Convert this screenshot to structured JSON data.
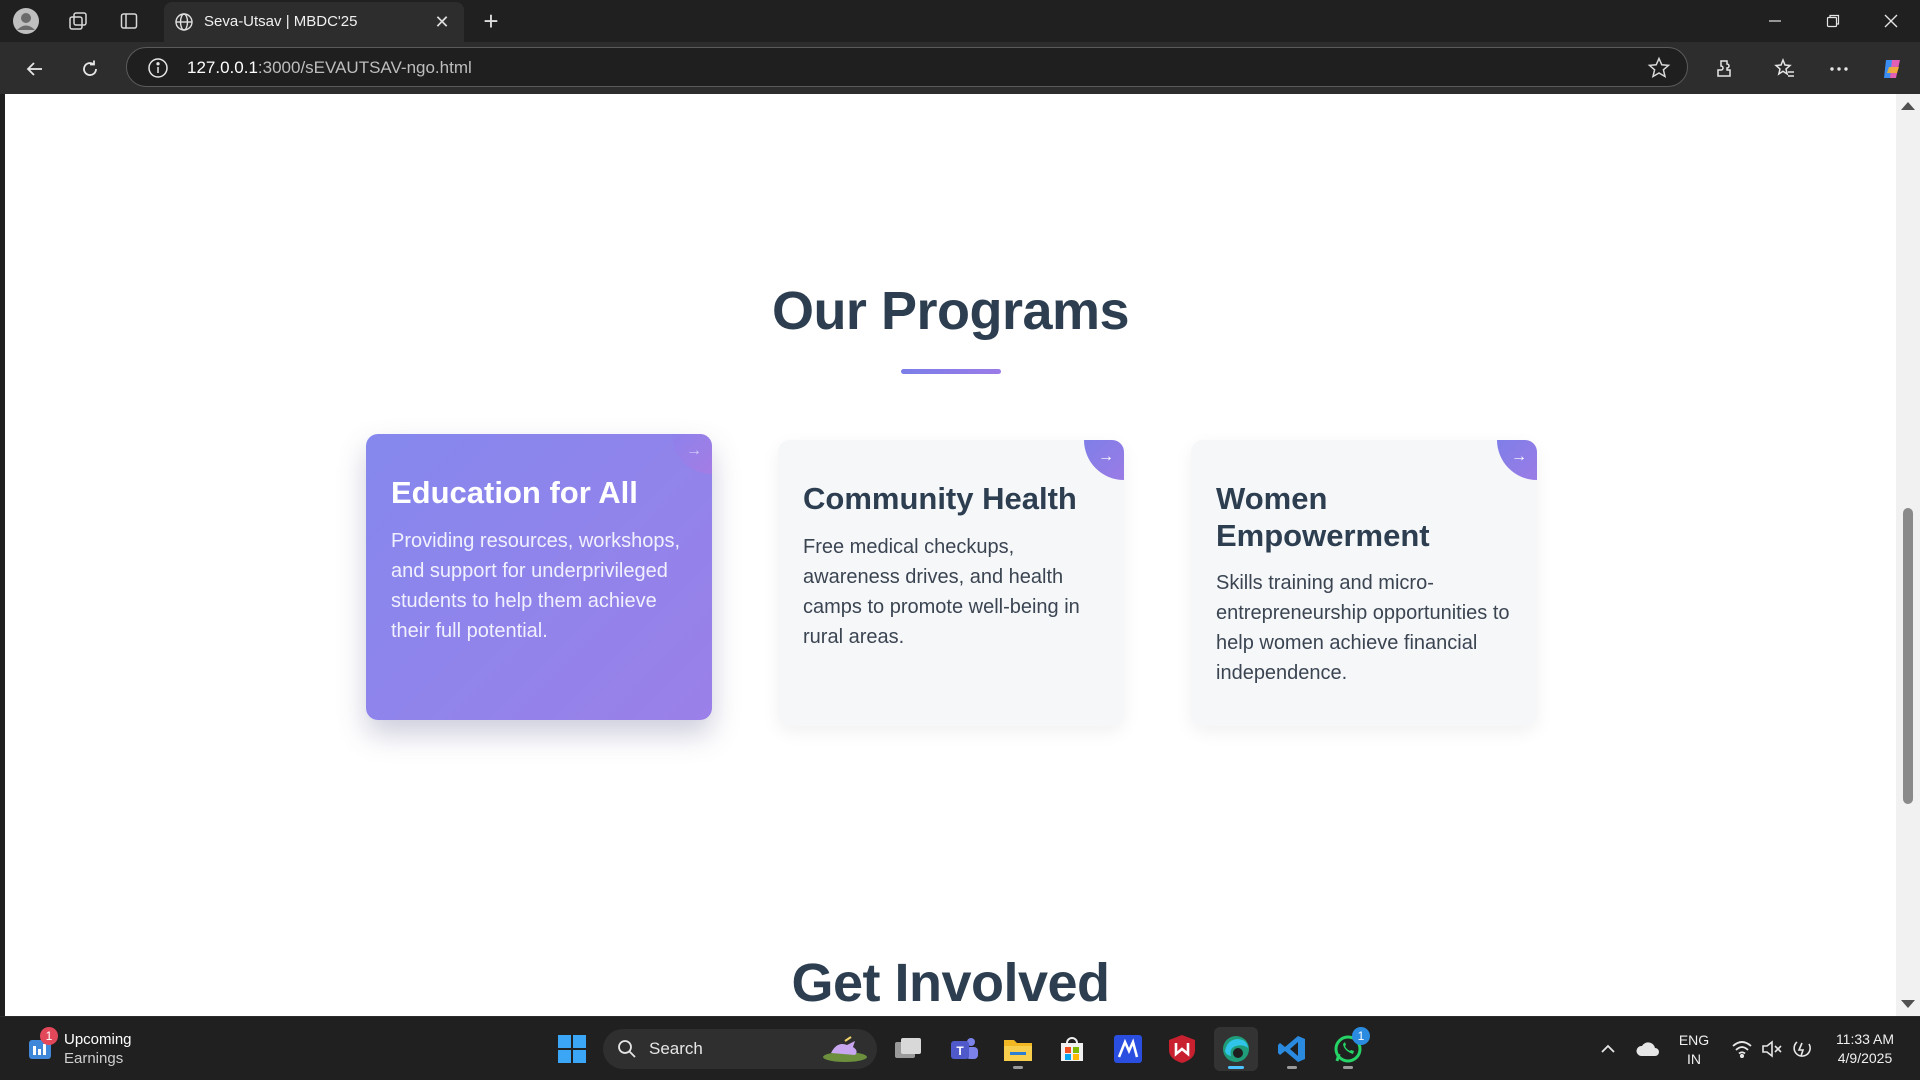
{
  "browser": {
    "tab_title": "Seva-Utsav | MBDC'25",
    "url_host": "127.0.0.1",
    "url_rest": ":3000/sEVAUTSAV-ngo.html"
  },
  "page": {
    "programs_title": "Our Programs",
    "next_section_title": "Get Involved",
    "cards": [
      {
        "title": "Education for All",
        "description": "Providing resources, workshops, and support for underprivileged students to help them achieve their full potential.",
        "arrow": "→"
      },
      {
        "title": "Community Health",
        "description": "Free medical checkups, awareness drives, and health camps to promote well-being in rural areas.",
        "arrow": "→"
      },
      {
        "title": "Women Empowerment",
        "description": "Skills training and micro-entrepreneurship opportunities to help women achieve financial independence.",
        "arrow": "→"
      }
    ],
    "accent_color": "#8a84ec",
    "heading_color": "#2c3e50"
  },
  "taskbar": {
    "widget_title": "Upcoming",
    "widget_subtitle": "Earnings",
    "widget_badge": "1",
    "search_label": "Search",
    "whatsapp_badge": "1",
    "language_top": "ENG",
    "language_bottom": "IN",
    "time": "11:33 AM",
    "date": "4/9/2025"
  }
}
